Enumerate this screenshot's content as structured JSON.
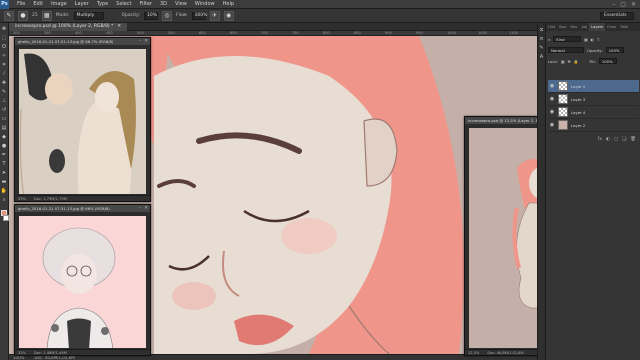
{
  "menubar": {
    "logo": "Ps",
    "items": [
      "File",
      "Edit",
      "Image",
      "Layer",
      "Type",
      "Select",
      "Filter",
      "3D",
      "View",
      "Window",
      "Help"
    ],
    "controls": [
      "–",
      "▢",
      "✕"
    ]
  },
  "options": {
    "brush_size": "25",
    "mode_label": "Mode:",
    "mode_value": "Multiply",
    "opacity_label": "Opacity:",
    "opacity_value": "10%",
    "flow_label": "Flow:",
    "flow_value": "100%",
    "workspace": "Essentials"
  },
  "tabs": [
    {
      "label": "increasepro.psd @ 100% (Layer 2, RGB/8) *",
      "close": "✕"
    }
  ],
  "windows": {
    "venus": {
      "title": "ghello_2016-01-21 07-51-13.jpg @ 66.7% (RGB/8)",
      "zoom": "33%",
      "doc": "Doc: 1,79M/1,79M"
    },
    "girl": {
      "title": "ghello_2016-01-21 07-51-13.jpg @ 66% (RGB/8)",
      "zoom": "33%",
      "doc": "Doc: 1,46M/1,46M"
    },
    "ref": {
      "title": "increasepro.psd @ 12,5% (Layer 2, RGB/8)",
      "zoom": "12,5%",
      "doc": "Doc: 46,8M/1,02,8M"
    }
  },
  "statusbar": {
    "zoom": "100%",
    "doc": "Doc: 46,8M/1,02,8M"
  },
  "ruler": [
    "300",
    "350",
    "400",
    "450",
    "500",
    "550",
    "600",
    "650",
    "700",
    "750",
    "800",
    "850",
    "900",
    "950",
    "1000",
    "1050",
    "1100"
  ],
  "panel": {
    "tabs": [
      "Hist",
      "Swa",
      "Nav",
      "Adj",
      "Layers",
      "Chan",
      "Path"
    ],
    "kind_label": "Kind",
    "blend_value": "Normal",
    "opacity_label": "Opacity:",
    "opacity_value": "100%",
    "lock_label": "Lock:",
    "fill_label": "Fill:",
    "fill_value": "100%",
    "layers": [
      {
        "name": "Layer 1",
        "selected": true,
        "thumb": "transparent"
      },
      {
        "name": "Layer 3",
        "selected": false,
        "thumb": "transparent"
      },
      {
        "name": "Layer 4",
        "selected": false,
        "thumb": "transparent"
      },
      {
        "name": "Layer 2",
        "selected": false,
        "thumb": "filled"
      }
    ],
    "foot_icons": [
      "fx",
      "◐",
      "▢",
      "❑",
      "🗑"
    ]
  },
  "colors": {
    "hair": "#f0958a",
    "skin": "#e8ddd3",
    "background": "#c4b0a8",
    "line": "#5a3e39",
    "foreground_swatch": "#e8907f",
    "selected_layer": "#4d6a8e"
  }
}
